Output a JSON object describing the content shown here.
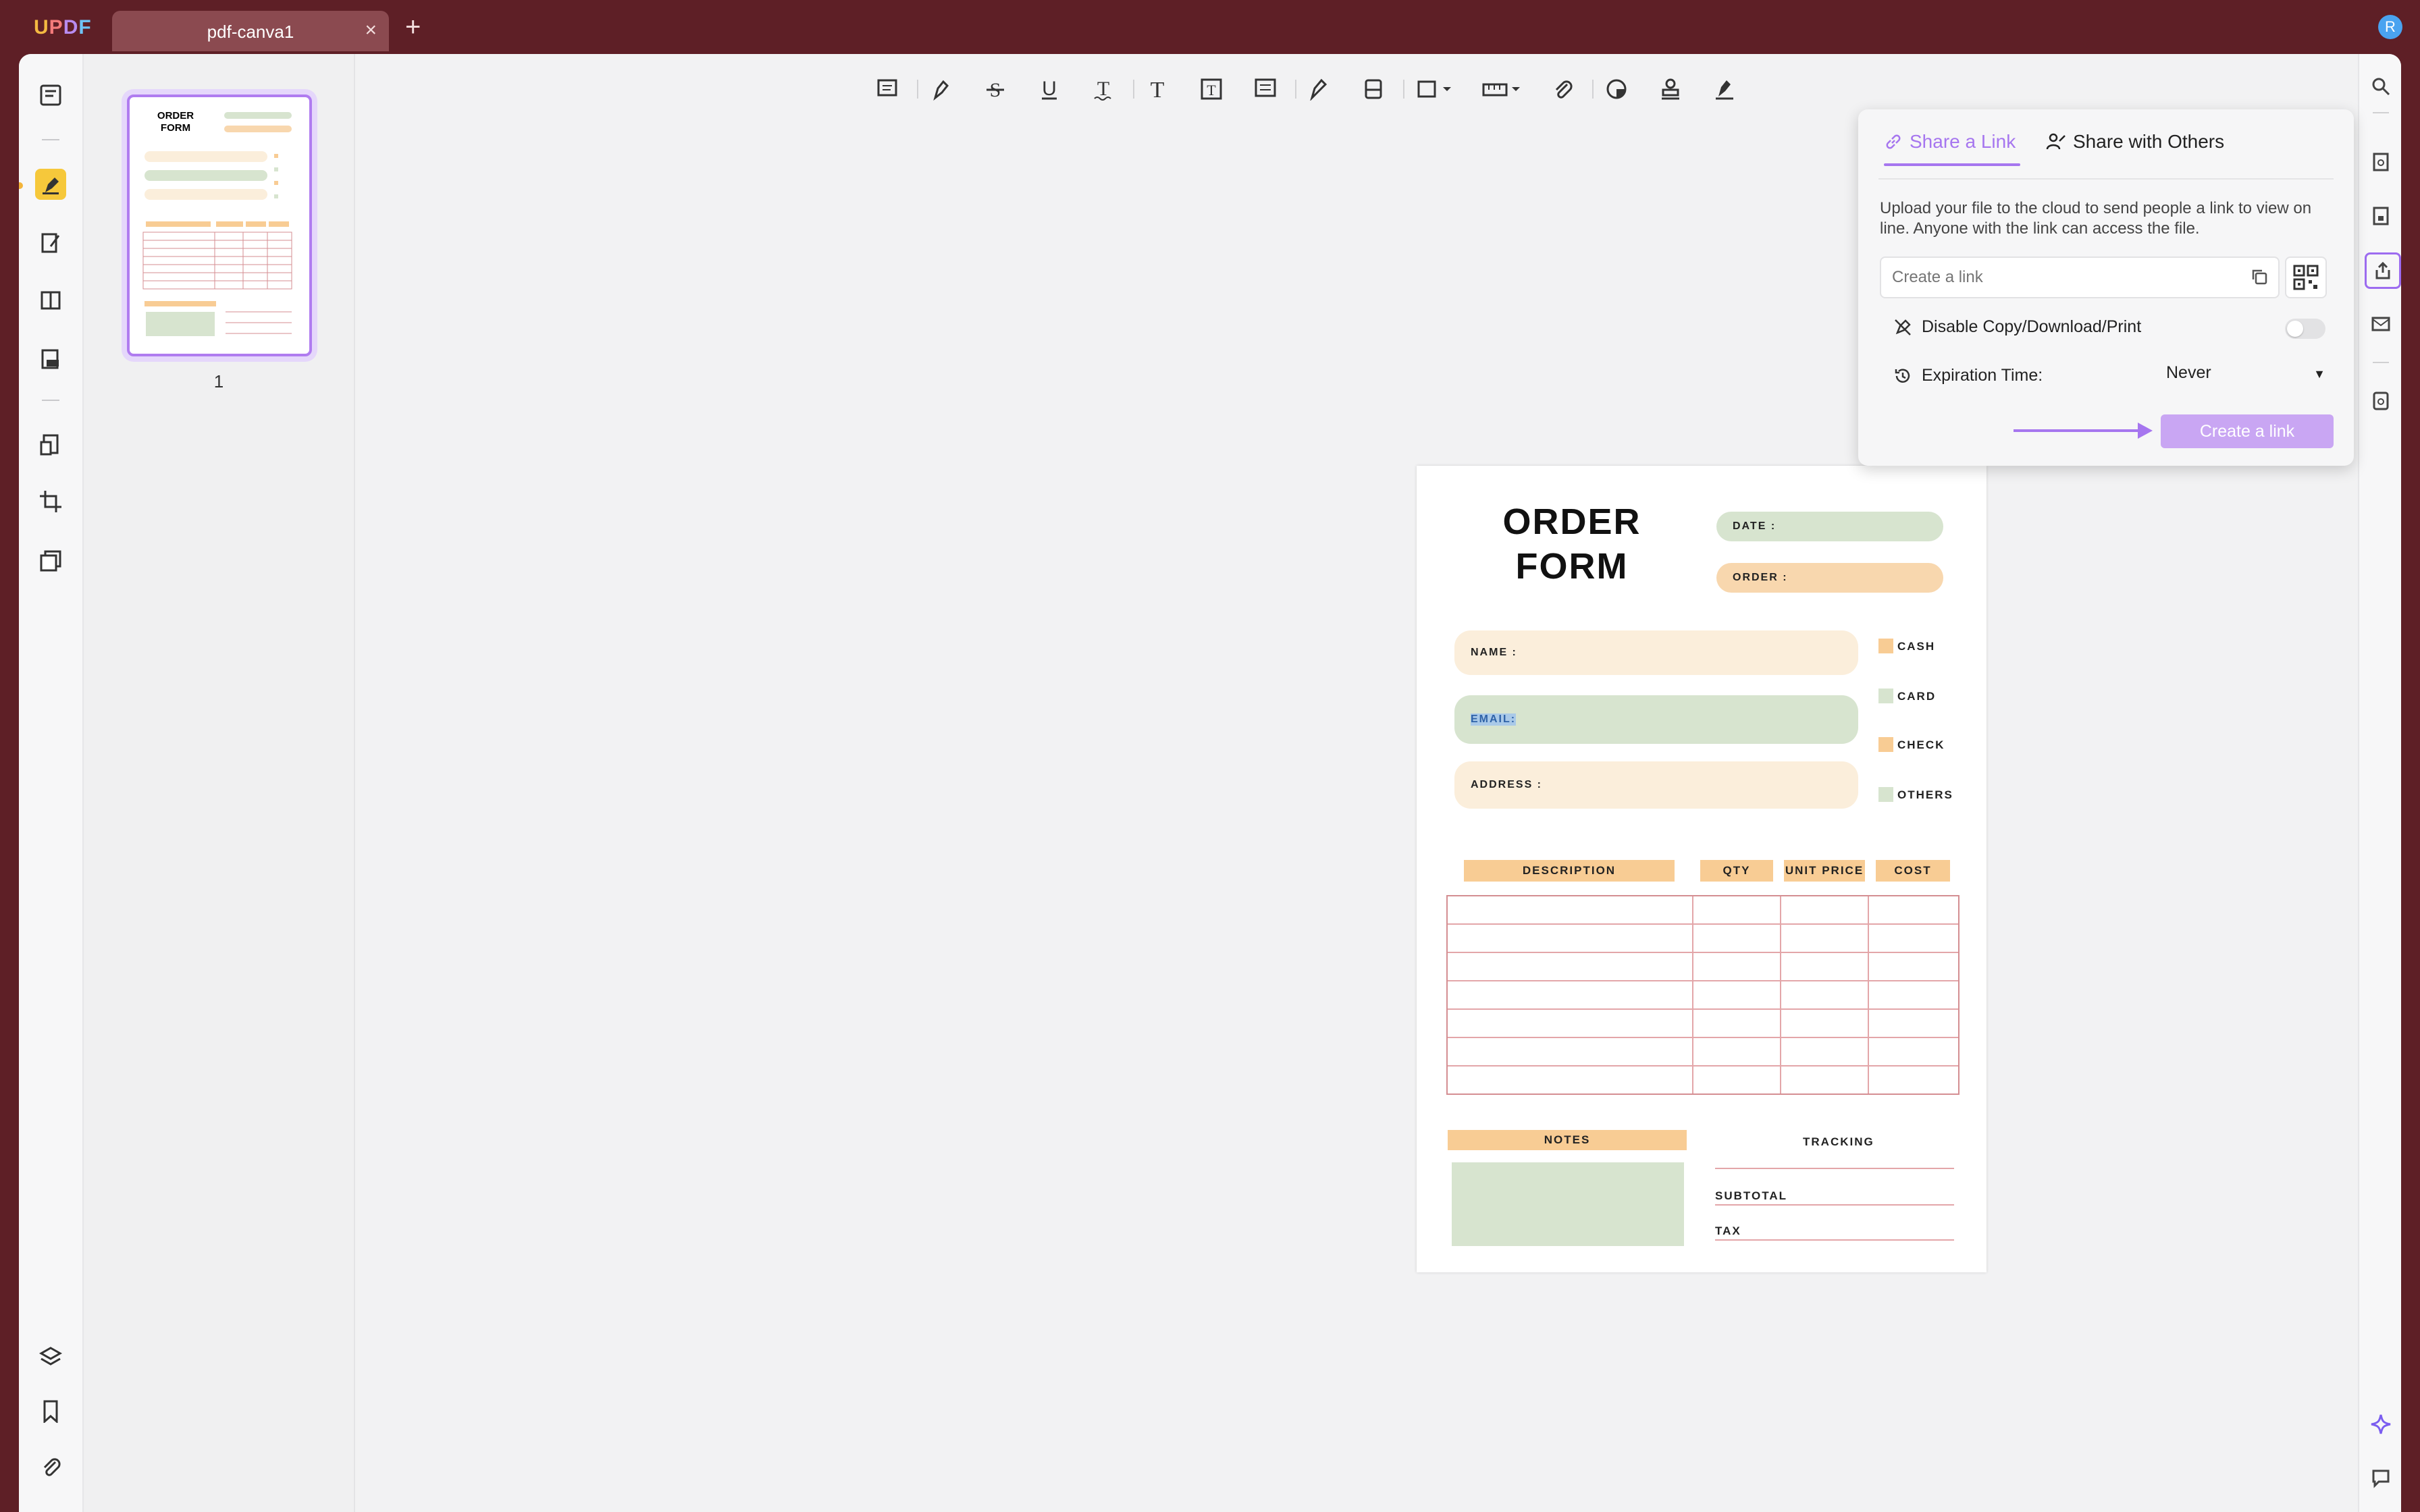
{
  "app": {
    "logo": "UPDF",
    "tab_title": "pdf-canva1",
    "tab_close": "×",
    "tab_add": "+",
    "avatar_initial": "R"
  },
  "thumbnails": [
    {
      "page_number": "1"
    }
  ],
  "share_popup": {
    "tabs": [
      {
        "label": "Share a Link",
        "active": true
      },
      {
        "label": "Share with Others",
        "active": false
      }
    ],
    "description": "Upload your file to the cloud to send people a link to view on line. Anyone with the link can access the file.",
    "link_placeholder": "Create a link",
    "disable_label": "Disable Copy/Download/Print",
    "disable_enabled": false,
    "expiration_label": "Expiration Time:",
    "expiration_value": "Never",
    "create_button": "Create a link"
  },
  "document": {
    "title_line1": "ORDER",
    "title_line2": "FORM",
    "date_label": "DATE :",
    "order_label": "ORDER :",
    "name_label": "NAME :",
    "email_label": "EMAIL:",
    "address_label": "ADDRESS :",
    "payment_options": [
      {
        "label": "CASH",
        "color": "#f8cc94"
      },
      {
        "label": "CARD",
        "color": "#d7e4cf"
      },
      {
        "label": "CHECK",
        "color": "#f8cc94"
      },
      {
        "label": "OTHERS",
        "color": "#d7e4cf"
      }
    ],
    "table_headers": [
      "DESCRIPTION",
      "QTY",
      "UNIT PRICE",
      "COST"
    ],
    "notes_label": "NOTES",
    "tracking_label": "TRACKING",
    "subtotal_label": "SUBTOTAL",
    "tax_label": "TAX"
  },
  "colors": {
    "accent": "#a676ef",
    "titlebar": "#5e1f26",
    "highlight_active": "#f6c83b"
  }
}
